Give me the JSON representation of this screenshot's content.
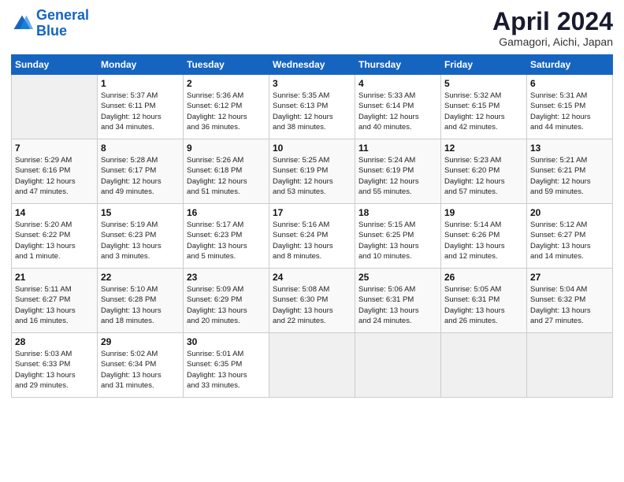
{
  "logo": {
    "line1": "General",
    "line2": "Blue"
  },
  "title": "April 2024",
  "subtitle": "Gamagori, Aichi, Japan",
  "weekdays": [
    "Sunday",
    "Monday",
    "Tuesday",
    "Wednesday",
    "Thursday",
    "Friday",
    "Saturday"
  ],
  "weeks": [
    [
      {
        "day": "",
        "info": ""
      },
      {
        "day": "1",
        "info": "Sunrise: 5:37 AM\nSunset: 6:11 PM\nDaylight: 12 hours\nand 34 minutes."
      },
      {
        "day": "2",
        "info": "Sunrise: 5:36 AM\nSunset: 6:12 PM\nDaylight: 12 hours\nand 36 minutes."
      },
      {
        "day": "3",
        "info": "Sunrise: 5:35 AM\nSunset: 6:13 PM\nDaylight: 12 hours\nand 38 minutes."
      },
      {
        "day": "4",
        "info": "Sunrise: 5:33 AM\nSunset: 6:14 PM\nDaylight: 12 hours\nand 40 minutes."
      },
      {
        "day": "5",
        "info": "Sunrise: 5:32 AM\nSunset: 6:15 PM\nDaylight: 12 hours\nand 42 minutes."
      },
      {
        "day": "6",
        "info": "Sunrise: 5:31 AM\nSunset: 6:15 PM\nDaylight: 12 hours\nand 44 minutes."
      }
    ],
    [
      {
        "day": "7",
        "info": "Sunrise: 5:29 AM\nSunset: 6:16 PM\nDaylight: 12 hours\nand 47 minutes."
      },
      {
        "day": "8",
        "info": "Sunrise: 5:28 AM\nSunset: 6:17 PM\nDaylight: 12 hours\nand 49 minutes."
      },
      {
        "day": "9",
        "info": "Sunrise: 5:26 AM\nSunset: 6:18 PM\nDaylight: 12 hours\nand 51 minutes."
      },
      {
        "day": "10",
        "info": "Sunrise: 5:25 AM\nSunset: 6:19 PM\nDaylight: 12 hours\nand 53 minutes."
      },
      {
        "day": "11",
        "info": "Sunrise: 5:24 AM\nSunset: 6:19 PM\nDaylight: 12 hours\nand 55 minutes."
      },
      {
        "day": "12",
        "info": "Sunrise: 5:23 AM\nSunset: 6:20 PM\nDaylight: 12 hours\nand 57 minutes."
      },
      {
        "day": "13",
        "info": "Sunrise: 5:21 AM\nSunset: 6:21 PM\nDaylight: 12 hours\nand 59 minutes."
      }
    ],
    [
      {
        "day": "14",
        "info": "Sunrise: 5:20 AM\nSunset: 6:22 PM\nDaylight: 13 hours\nand 1 minute."
      },
      {
        "day": "15",
        "info": "Sunrise: 5:19 AM\nSunset: 6:23 PM\nDaylight: 13 hours\nand 3 minutes."
      },
      {
        "day": "16",
        "info": "Sunrise: 5:17 AM\nSunset: 6:23 PM\nDaylight: 13 hours\nand 5 minutes."
      },
      {
        "day": "17",
        "info": "Sunrise: 5:16 AM\nSunset: 6:24 PM\nDaylight: 13 hours\nand 8 minutes."
      },
      {
        "day": "18",
        "info": "Sunrise: 5:15 AM\nSunset: 6:25 PM\nDaylight: 13 hours\nand 10 minutes."
      },
      {
        "day": "19",
        "info": "Sunrise: 5:14 AM\nSunset: 6:26 PM\nDaylight: 13 hours\nand 12 minutes."
      },
      {
        "day": "20",
        "info": "Sunrise: 5:12 AM\nSunset: 6:27 PM\nDaylight: 13 hours\nand 14 minutes."
      }
    ],
    [
      {
        "day": "21",
        "info": "Sunrise: 5:11 AM\nSunset: 6:27 PM\nDaylight: 13 hours\nand 16 minutes."
      },
      {
        "day": "22",
        "info": "Sunrise: 5:10 AM\nSunset: 6:28 PM\nDaylight: 13 hours\nand 18 minutes."
      },
      {
        "day": "23",
        "info": "Sunrise: 5:09 AM\nSunset: 6:29 PM\nDaylight: 13 hours\nand 20 minutes."
      },
      {
        "day": "24",
        "info": "Sunrise: 5:08 AM\nSunset: 6:30 PM\nDaylight: 13 hours\nand 22 minutes."
      },
      {
        "day": "25",
        "info": "Sunrise: 5:06 AM\nSunset: 6:31 PM\nDaylight: 13 hours\nand 24 minutes."
      },
      {
        "day": "26",
        "info": "Sunrise: 5:05 AM\nSunset: 6:31 PM\nDaylight: 13 hours\nand 26 minutes."
      },
      {
        "day": "27",
        "info": "Sunrise: 5:04 AM\nSunset: 6:32 PM\nDaylight: 13 hours\nand 27 minutes."
      }
    ],
    [
      {
        "day": "28",
        "info": "Sunrise: 5:03 AM\nSunset: 6:33 PM\nDaylight: 13 hours\nand 29 minutes."
      },
      {
        "day": "29",
        "info": "Sunrise: 5:02 AM\nSunset: 6:34 PM\nDaylight: 13 hours\nand 31 minutes."
      },
      {
        "day": "30",
        "info": "Sunrise: 5:01 AM\nSunset: 6:35 PM\nDaylight: 13 hours\nand 33 minutes."
      },
      {
        "day": "",
        "info": ""
      },
      {
        "day": "",
        "info": ""
      },
      {
        "day": "",
        "info": ""
      },
      {
        "day": "",
        "info": ""
      }
    ]
  ]
}
